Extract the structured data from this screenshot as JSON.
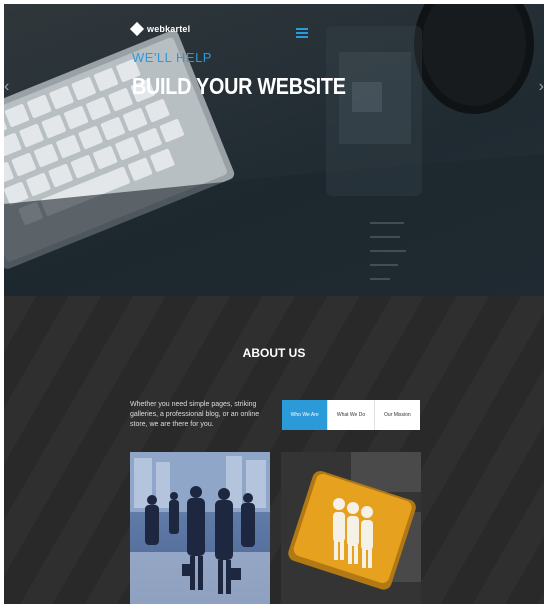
{
  "hero": {
    "brand": "webkartel",
    "kicker": "WE'LL HELP",
    "title": "BUILD YOUR WEBSITE"
  },
  "about": {
    "title": "ABOUT US",
    "text": "Whether you need simple pages, striking galleries, a professional blog, or an online store, we are there for you.",
    "tabs": [
      {
        "label": "Who We Are",
        "active": true
      },
      {
        "label": "What We Do",
        "active": false
      },
      {
        "label": "Our Mission",
        "active": false
      }
    ]
  },
  "colors": {
    "accent": "#2a9ad8",
    "section_bg": "#2b2b2b",
    "key_yellow": "#e6a11f"
  },
  "icons": [
    "diamond-logo-icon",
    "hamburger-menu-icon",
    "arrow-left-icon",
    "arrow-right-icon",
    "people-icon"
  ]
}
